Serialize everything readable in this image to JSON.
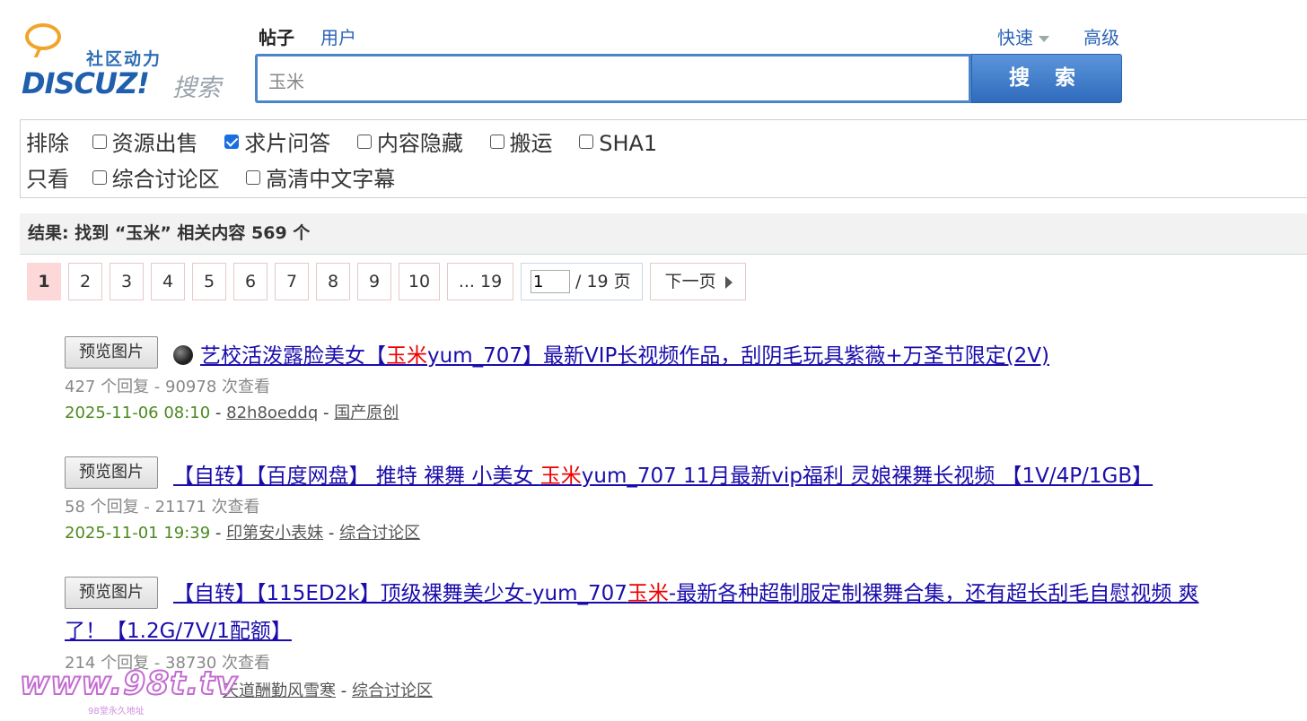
{
  "logo": {
    "slogan": "社区动力",
    "brand": "DISCUZ!",
    "search_word": "搜索"
  },
  "tabs": {
    "posts": "帖子",
    "users": "用户"
  },
  "header": {
    "quick": "快速",
    "advanced": "高级"
  },
  "search": {
    "value": "玉米",
    "button": "搜 索"
  },
  "filters": {
    "exclude_label": "排除",
    "exclude_options": [
      {
        "label": "资源出售",
        "checked": false
      },
      {
        "label": "求片问答",
        "checked": true
      },
      {
        "label": "内容隐藏",
        "checked": false
      },
      {
        "label": "搬运",
        "checked": false
      },
      {
        "label": "SHA1",
        "checked": false
      }
    ],
    "only_label": "只看",
    "only_options": [
      {
        "label": "综合讨论区",
        "checked": false
      },
      {
        "label": "高清中文字幕",
        "checked": false
      }
    ]
  },
  "result_summary": "结果: 找到 “玉米” 相关内容 569 个",
  "pagination": {
    "current": "1",
    "pages": [
      "2",
      "3",
      "4",
      "5",
      "6",
      "7",
      "8",
      "9",
      "10"
    ],
    "last": "... 19",
    "jump_value": "1",
    "total": "/ 19 页",
    "next": "下一页"
  },
  "results": [
    {
      "preview_button": "预览图片",
      "title_before": "艺校活泼露脸美女【",
      "title_highlight": "玉米",
      "title_after": "yum_707】最新VIP长视频作品，刮阴毛玩具紫薇+万圣节限定(2V)",
      "stats": "427 个回复 - 90978 次查看",
      "date": "2025-11-06 08:10",
      "author": "82h8oeddq",
      "forum": "国产原创"
    },
    {
      "preview_button": "预览图片",
      "title_before": "【自转】【百度网盘】 推特 裸舞 小美女 ",
      "title_highlight": "玉米",
      "title_after": "yum_707 11月最新vip福利 灵娘裸舞长视频 【1V/4P/1GB】",
      "stats": "58 个回复 - 21171 次查看",
      "date": "2025-11-01 19:39",
      "author": "印第安小表妹",
      "forum": "综合讨论区"
    },
    {
      "preview_button": "预览图片",
      "title_before": "【自转】【115ED2k】顶级裸舞美少女-yum_707",
      "title_highlight": "玉米",
      "title_after": "-最新各种超制服定制裸舞合集，还有超长刮毛自慰视频 爽了！【1.2G/7V/1配额】",
      "stats": "214 个回复 - 38730 次查看",
      "date": "",
      "author": "天道酬勤风雪寒",
      "forum": "综合讨论区"
    }
  ],
  "watermark": {
    "text": "www.98t.tv",
    "sub": "98堂永久地址"
  }
}
